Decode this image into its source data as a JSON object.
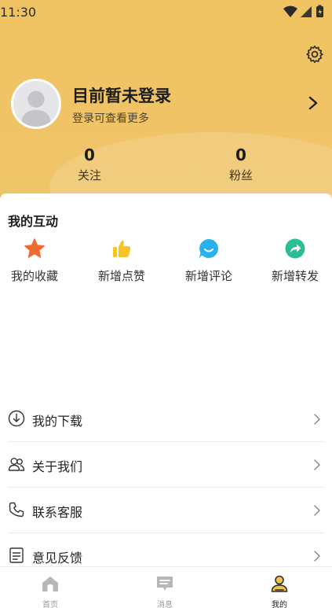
{
  "status_bar": {
    "time": "11:30",
    "icons": [
      "wifi-icon",
      "signal-icon",
      "battery-icon"
    ]
  },
  "profile": {
    "title": "目前暂未登录",
    "subtitle": "登录可查看更多",
    "stats": [
      {
        "value": "0",
        "label": "关注"
      },
      {
        "value": "0",
        "label": "粉丝"
      }
    ]
  },
  "interactions": {
    "title": "我的互动",
    "items": [
      {
        "label": "我的收藏",
        "icon": "star-icon",
        "color": "#ef6c31"
      },
      {
        "label": "新增点赞",
        "icon": "thumbs-up-icon",
        "color": "#f7c325"
      },
      {
        "label": "新增评论",
        "icon": "comment-icon",
        "color": "#27b1ee"
      },
      {
        "label": "新增转发",
        "icon": "share-icon",
        "color": "#2bbd94"
      }
    ]
  },
  "menu": [
    {
      "label": "我的下载",
      "icon": "download-icon"
    },
    {
      "label": "关于我们",
      "icon": "users-icon"
    },
    {
      "label": "联系客服",
      "icon": "phone-icon"
    },
    {
      "label": "意见反馈",
      "icon": "feedback-icon"
    }
  ],
  "nav": [
    {
      "label": "首页",
      "icon": "home-icon",
      "active": false
    },
    {
      "label": "消息",
      "icon": "message-icon",
      "active": false
    },
    {
      "label": "我的",
      "icon": "profile-icon",
      "active": true
    }
  ],
  "colors": {
    "header": "#efc361",
    "active_nav": "#f0c24e"
  }
}
